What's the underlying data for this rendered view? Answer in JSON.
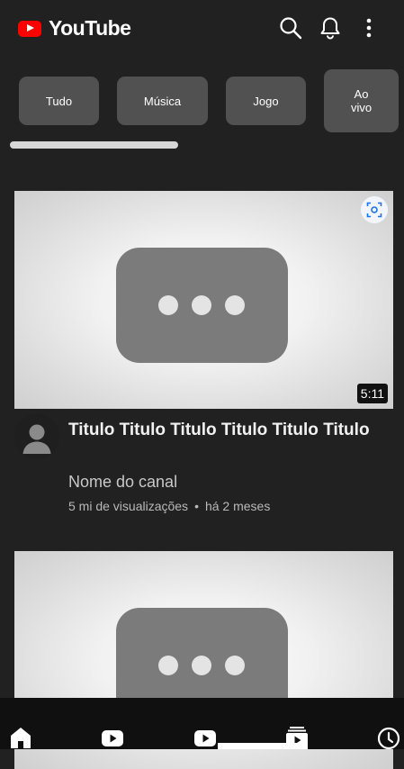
{
  "app": {
    "title": "YouTube"
  },
  "chips": [
    {
      "label": "Tudo"
    },
    {
      "label": "Música"
    },
    {
      "label": "Jogo"
    },
    {
      "label": "Ao vivo"
    }
  ],
  "videos": [
    {
      "duration": "5:11",
      "title": "Titulo Titulo Titulo Titulo Titulo Titulo",
      "channel": "Nome do canal",
      "views": "5 mi de visualizações",
      "separator": "•",
      "age": "há 2 meses"
    },
    {
      "duration": "",
      "title": "",
      "channel": "",
      "views": "",
      "separator": "",
      "age": ""
    }
  ],
  "nav": [
    {
      "icon": "home-icon"
    },
    {
      "icon": "shorts-icon"
    },
    {
      "icon": "subscriptions-icon"
    },
    {
      "icon": "library-icon"
    },
    {
      "icon": "history-icon"
    }
  ],
  "colors": {
    "background": "#212121",
    "brand": "#ff0000",
    "chip": "#515151"
  }
}
